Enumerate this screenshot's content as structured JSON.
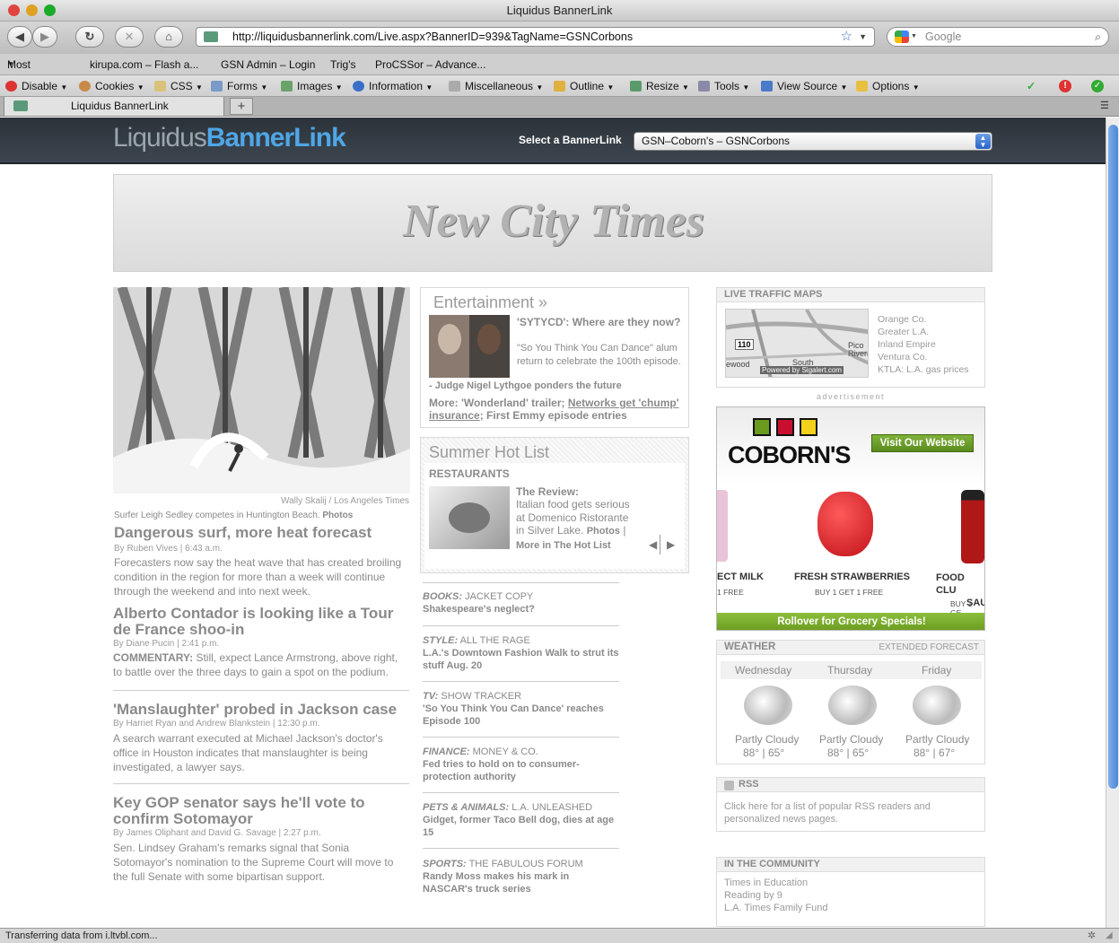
{
  "window": {
    "title": "Liquidus BannerLink"
  },
  "nav": {
    "url": "http://liquidusbannerlink.com/Live.aspx?BannerID=939&TagName=GSNCorbons",
    "search_placeholder": "Google"
  },
  "bookmarks": [
    "Most Visited",
    "kirupa.com – Flash a...",
    "GSN Admin – Login",
    "Trig's",
    "ProCSSor – Advance..."
  ],
  "devtoolbar": [
    "Disable",
    "Cookies",
    "CSS",
    "Forms",
    "Images",
    "Information",
    "Miscellaneous",
    "Outline",
    "Resize",
    "Tools",
    "View Source",
    "Options"
  ],
  "tab": {
    "label": "Liquidus BannerLink",
    "new_tab": "+"
  },
  "site": {
    "logo_a": "Liquidus",
    "logo_b": "BannerLink",
    "select_label": "Select a BannerLink",
    "select_value": "GSN–Coborn's – GSNCorbons"
  },
  "masthead": {
    "name": "New City Times"
  },
  "lead": {
    "credit": "Wally Skalij / Los Angeles Times",
    "caption": "Surfer Leigh Sedley competes in Huntington Beach.",
    "caption_link": "Photos",
    "headline": "Dangerous surf, more heat forecast",
    "byline": "By Ruben Vives | 6:43 a.m.",
    "body": "Forecasters now say the heat wave that has created broiling condition in the region for more than a week will continue through the weekend and into next week."
  },
  "stories": [
    {
      "headline": "Alberto Contador is looking like a Tour de France shoo-in",
      "byline": "By Diane Pucin | 2:41 p.m.",
      "prefix": "COMMENTARY:",
      "body": " Still, expect Lance Armstrong, above right, to battle over the three days to gain a spot on the podium."
    },
    {
      "headline": "'Manslaughter' probed in Jackson case",
      "byline": "By Harriet Ryan and Andrew Blankstein | 12:30 p.m.",
      "body": "A search warrant executed at Michael Jackson's doctor's office in Houston indicates that manslaughter is being investigated, a lawyer says."
    },
    {
      "headline": "Key GOP senator says he'll vote to confirm Sotomayor",
      "byline": "By James Oliphant and David G. Savage | 2:27 p.m.",
      "body": "Sen. Lindsey Graham's remarks signal that Sonia Sotomayor's nomination to the Supreme Court will move to the full Senate with some bipartisan support."
    }
  ],
  "entertainment": {
    "title": "Entertainment »",
    "headline": "'SYTYCD': Where are they now?",
    "body": "\"So You Think You Can Dance\" alum return to celebrate the 100th episode.",
    "sub": "- Judge Nigel Lythgoe ponders the future",
    "more_prefix": "More: 'Wonderland' trailer;",
    "more_link": "Networks get 'chump' insurance",
    "more_suffix": "; First Emmy episode entries"
  },
  "hotlist": {
    "title": "Summer Hot List",
    "section": "RESTAURANTS",
    "lead": "The Review:",
    "body": "Italian food gets serious at Domenico Ristorante in Silver Lake.",
    "photos": "Photos",
    "sep": "|",
    "more": "More in The Hot List"
  },
  "sections": [
    {
      "cat": "BOOKS:",
      "title": "JACKET COPY",
      "text": "Shakespeare's neglect?"
    },
    {
      "cat": "STYLE:",
      "title": "ALL THE RAGE",
      "text": "L.A.'s Downtown Fashion Walk to strut its stuff Aug. 20"
    },
    {
      "cat": "TV:",
      "title": "SHOW TRACKER",
      "text": "'So You Think You Can Dance' reaches Episode 100"
    },
    {
      "cat": "FINANCE:",
      "title": "MONEY & CO.",
      "text": "Fed tries to hold on to consumer-protection authority"
    },
    {
      "cat": "PETS & ANIMALS:",
      "title": "L.A. UNLEASHED",
      "text": "Gidget, former Taco Bell dog, dies at age 15"
    },
    {
      "cat": "SPORTS:",
      "title": "THE FABULOUS FORUM",
      "text": "Randy Moss makes his mark in NASCAR's truck series"
    }
  ],
  "traffic": {
    "title": "LIVE TRAFFIC MAPS",
    "links": [
      "Orange Co.",
      "Greater L.A.",
      "Inland Empire",
      "Ventura Co.",
      "KTLA: L.A. gas prices"
    ],
    "map_labels": {
      "hwy": "110",
      "pico": "Pico",
      "rivera": "Rivera",
      "wood": "ewood",
      "south": "South",
      "powered": "Powered by Sigalert.com"
    }
  },
  "ad": {
    "label": "advertisement",
    "brand": "COBORN'S",
    "cta": "Visit Our Website",
    "items": [
      {
        "name": "ECT MILK",
        "deal": "1 FREE"
      },
      {
        "name": "FRESH STRAWBERRIES",
        "deal": "BUY 1 GET 1 FREE"
      },
      {
        "name": "FOOD CLU",
        "name2": "SAU",
        "deal": "BUY 1 GE"
      }
    ],
    "footer": "Rollover for Grocery Specials!",
    "colors": {
      "green": "#6a9a1e",
      "red": "#c8102e",
      "yellow": "#f3d11b"
    }
  },
  "weather": {
    "title": "WEATHER",
    "extended": "EXTENDED FORECAST",
    "days": [
      {
        "day": "Wednesday",
        "cond": "Partly Cloudy",
        "hi": "88°",
        "lo": "65°"
      },
      {
        "day": "Thursday",
        "cond": "Partly Cloudy",
        "hi": "88°",
        "lo": "65°"
      },
      {
        "day": "Friday",
        "cond": "Partly Cloudy",
        "hi": "88°",
        "lo": "67°"
      }
    ],
    "sep": "|"
  },
  "rss": {
    "title": "RSS",
    "text": "Click here for a list of popular RSS readers and personalized news pages."
  },
  "community": {
    "title": "IN THE COMMUNITY",
    "links": [
      "Times in Education",
      "Reading by 9",
      "L.A. Times Family Fund"
    ]
  },
  "status": {
    "text": "Transferring data from i.ltvbl.com..."
  }
}
